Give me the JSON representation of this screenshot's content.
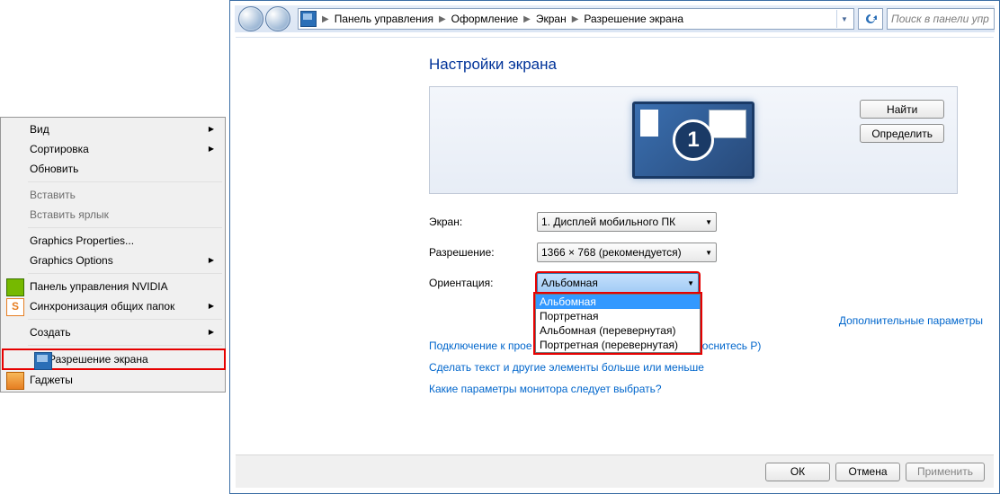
{
  "context_menu": {
    "items": [
      {
        "label": "Вид",
        "arrow": true
      },
      {
        "label": "Сортировка",
        "arrow": true
      },
      {
        "label": "Обновить"
      },
      {
        "sep": true
      },
      {
        "label": "Вставить",
        "disabled": true
      },
      {
        "label": "Вставить ярлык",
        "disabled": true
      },
      {
        "sep": true
      },
      {
        "label": "Graphics Properties..."
      },
      {
        "label": "Graphics Options",
        "arrow": true
      },
      {
        "sep": true
      },
      {
        "label": "Панель управления NVIDIA",
        "icon": "nvidia"
      },
      {
        "label": "Синхронизация общих папок",
        "icon": "sync",
        "arrow": true
      },
      {
        "sep": true
      },
      {
        "label": "Создать",
        "arrow": true
      },
      {
        "sep": true
      },
      {
        "label": "Разрешение экрана",
        "icon": "screen",
        "highlight": true
      },
      {
        "label": "Гаджеты",
        "icon": "gadget"
      }
    ]
  },
  "breadcrumb": [
    "Панель управления",
    "Оформление",
    "Экран",
    "Разрешение экрана"
  ],
  "search_placeholder": "Поиск в панели упр",
  "title": "Настройки экрана",
  "monitor_number": "1",
  "btn_find": "Найти",
  "btn_identify": "Определить",
  "labels": {
    "display": "Экран:",
    "resolution": "Разрешение:",
    "orientation": "Ориентация:"
  },
  "display_value": "1. Дисплей мобильного ПК",
  "resolution_value": "1366 × 768 (рекомендуется)",
  "orientation_value": "Альбомная",
  "orientation_options": [
    "Альбомная",
    "Портретная",
    "Альбомная (перевернутая)",
    "Портретная (перевернутая)"
  ],
  "extra_link": "Дополнительные параметры",
  "projector_text": "Подключение к проектору (или нажмите клавишу й и коснитесь P)",
  "projector_text_visible_left": "Подключение к прое",
  "projector_text_visible_right": "й и коснитесь P)",
  "link_text_size": "Сделать текст и другие элементы больше или меньше",
  "link_which": "Какие параметры монитора следует выбрать?",
  "btn_ok": "ОК",
  "btn_cancel": "Отмена",
  "btn_apply": "Применить"
}
